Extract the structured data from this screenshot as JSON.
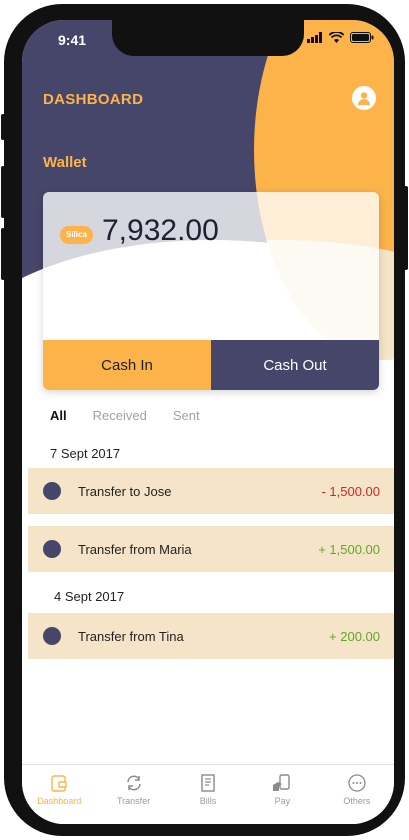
{
  "status": {
    "time": "9:41"
  },
  "header": {
    "title": "DASHBOARD",
    "avatar_icon": "user-icon"
  },
  "wallet": {
    "label": "Wallet",
    "currency_badge": "Silica",
    "balance": "7,932.00",
    "cash_in_label": "Cash In",
    "cash_out_label": "Cash Out"
  },
  "filters": [
    {
      "label": "All",
      "active": true
    },
    {
      "label": "Received",
      "active": false
    },
    {
      "label": "Sent",
      "active": false
    }
  ],
  "groups": [
    {
      "date": "7 Sept 2017",
      "transactions": [
        {
          "label": "Transfer to Jose",
          "amount": "- 1,500.00",
          "kind": "debit"
        },
        {
          "label": "Transfer from Maria",
          "amount": "+ 1,500.00",
          "kind": "credit"
        }
      ]
    },
    {
      "date": "4 Sept 2017",
      "transactions": [
        {
          "label": "Transfer from Tina",
          "amount": "+ 200.00",
          "kind": "credit"
        }
      ]
    }
  ],
  "tabs": [
    {
      "label": "Dashboard",
      "icon": "wallet-icon",
      "active": true
    },
    {
      "label": "Transfer",
      "icon": "transfer-icon",
      "active": false
    },
    {
      "label": "Bills",
      "icon": "bills-icon",
      "active": false
    },
    {
      "label": "Pay",
      "icon": "pay-icon",
      "active": false
    },
    {
      "label": "Others",
      "icon": "more-icon",
      "active": false
    }
  ],
  "colors": {
    "accent": "#fcb34a",
    "navy": "#46466a",
    "row_background": "#f5e4c7",
    "debit": "#e02020",
    "credit": "#62a82a"
  }
}
